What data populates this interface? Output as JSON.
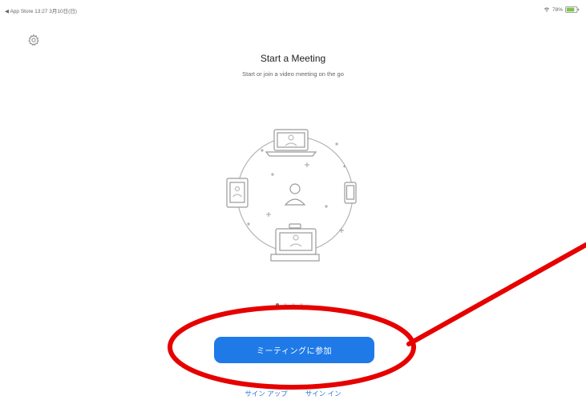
{
  "status_bar": {
    "left_text": "◀ App Store  13:27  3月10日(日)",
    "right_text": "78%"
  },
  "header": {
    "title": "Start a Meeting",
    "subtitle": "Start or join a video meeting on the go"
  },
  "pager": {
    "count": 4,
    "active_index": 0
  },
  "actions": {
    "join_label": "ミーティングに参加",
    "signup_label": "サイン アップ",
    "signin_label": "サイン イン"
  },
  "icons": {
    "settings": "gear-icon",
    "wifi": "wifi-icon",
    "battery": "battery-icon"
  },
  "colors": {
    "primary_blue": "#1f7ae8",
    "link_blue": "#2d78d6",
    "annotation_red": "#e60000"
  }
}
